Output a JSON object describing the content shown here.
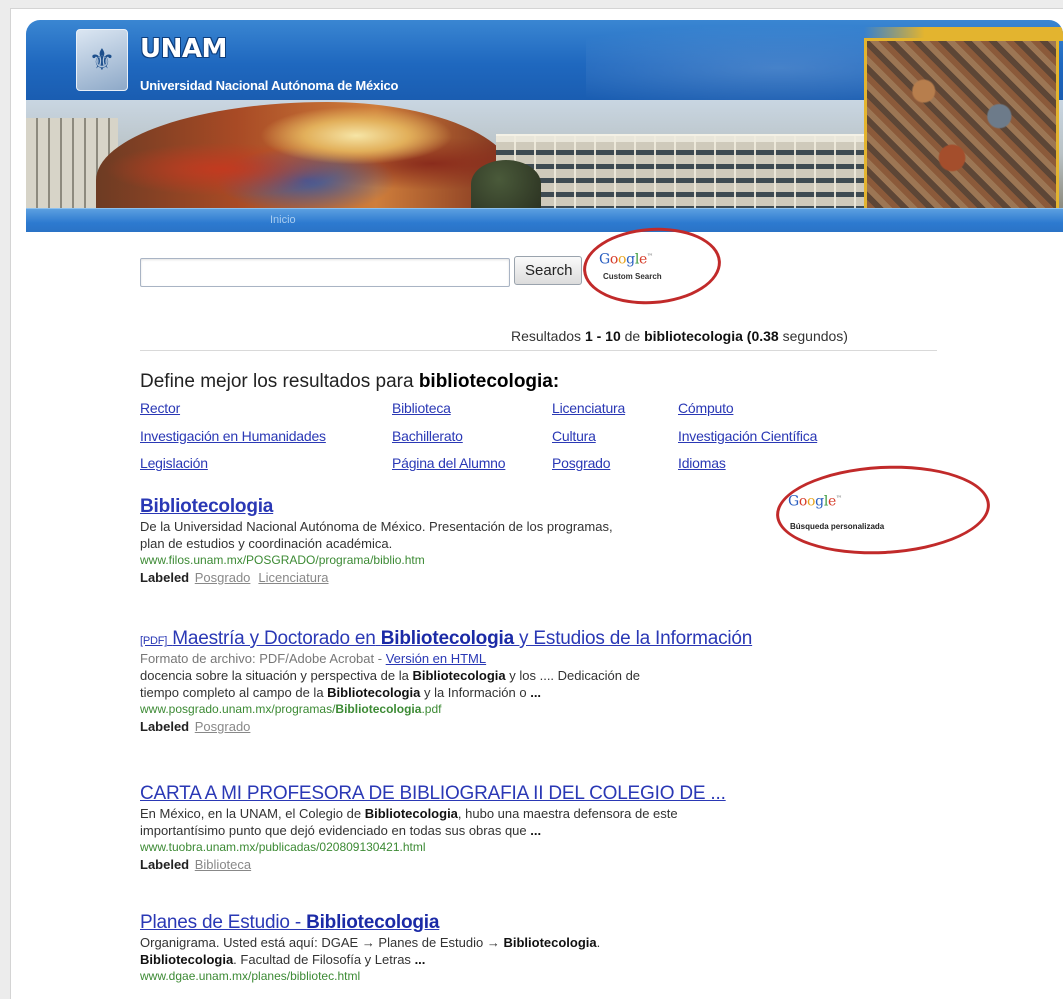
{
  "header": {
    "crest_icon": "unam-crest-icon",
    "title": "UNAM",
    "subtitle": "Universidad Nacional Autónoma de México",
    "nav_inicio": "Inicio"
  },
  "search": {
    "query": "",
    "button_label": "Search",
    "google_logo": "Google",
    "google_label": "Custom Search"
  },
  "results_info": {
    "prefix": "Resultados",
    "range": "1 - 10",
    "de": "de",
    "query": "bibliotecologia",
    "time": "(0.38",
    "seconds": "segundos)"
  },
  "refine": {
    "prefix": "Define mejor los resultados para",
    "query": "bibliotecologia:",
    "links": [
      "Rector",
      "Biblioteca",
      "Licenciatura",
      "Cómputo",
      "Investigación en Humanidades",
      "Bachillerato",
      "Cultura",
      "Investigación Científica",
      "Legislación",
      "Página del Alumno",
      "Posgrado",
      "Idiomas"
    ]
  },
  "google_personalized": {
    "logo": "Google",
    "label": "Búsqueda personalizada"
  },
  "results": [
    {
      "title": "Bibliotecologia",
      "snippet1": "De la Universidad Nacional Autónoma de México. Presentación de los programas,",
      "snippet2": "plan de estudios y coordinación académica.",
      "url": "www.filos.unam.mx/POSGRADO/programa/biblio.htm",
      "labeled": "Labeled",
      "labels": [
        "Posgrado",
        "Licenciatura"
      ]
    },
    {
      "pdf_tag": "[PDF]",
      "title_a": "Maestría y Doctorado en",
      "title_b": "Bibliotecologia",
      "title_c": "y Estudios de la Información",
      "format": "Formato de archivo: PDF/Adobe Acrobat -",
      "html_version": "Versión en HTML",
      "s1a": "docencia sobre la situación y perspectiva de la",
      "s1b": "Bibliotecologia",
      "s1c": "y los .... Dedicación de",
      "s2a": "tiempo completo al campo de la",
      "s2b": "Bibliotecologia",
      "s2c": "y la Información o",
      "s2d": "...",
      "url_a": "www.posgrado.unam.mx/programas/",
      "url_b": "Bibliotecologia",
      "url_c": ".pdf",
      "labeled": "Labeled",
      "labels": [
        "Posgrado"
      ]
    },
    {
      "title": "CARTA A MI PROFESORA DE BIBLIOGRAFIA II DEL COLEGIO DE ...",
      "s1a": "En México, en la UNAM, el Colegio de",
      "s1b": "Bibliotecologia",
      "s1c": ", hubo una maestra defensora de este",
      "s2a": "importantísimo punto que dejó evidenciado en todas sus obras que",
      "s2b": "...",
      "url": "www.tuobra.unam.mx/publicadas/020809130421.html",
      "labeled": "Labeled",
      "labels": [
        "Biblioteca"
      ]
    },
    {
      "title_a": "Planes de Estudio -",
      "title_b": "Bibliotecologia",
      "s1a": "Organigrama. Usted está aquí: DGAE → Planes de Estudio →",
      "s1b": "Bibliotecologia",
      "s1c": ".",
      "s2a": "Bibliotecologia",
      "s2b": ". Facultad de Filosofía y Letras",
      "s2c": "...",
      "url": "www.dgae.unam.mx/planes/bibliotec.html"
    }
  ],
  "colors": {
    "header_blue": "#1f68bf",
    "link_blue": "#2a38b5",
    "url_green": "#3c8a34",
    "annotation_red": "#c12a2a"
  }
}
